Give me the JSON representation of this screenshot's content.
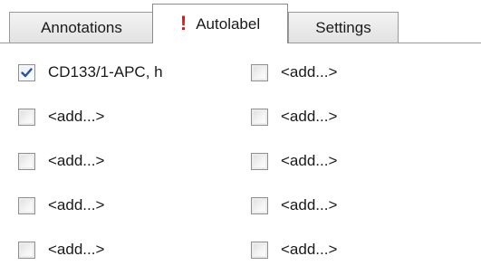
{
  "tabs": {
    "annotations": "Annotations",
    "autolabel": "Autolabel",
    "settings": "Settings",
    "active": "autolabel"
  },
  "icons": {
    "autolabel_tab_icon": "exclamation-alert-icon",
    "checkbox_checked_icon": "checkmark-icon"
  },
  "colors": {
    "alert": "#e51414",
    "checkmark": "#2a4f9c"
  },
  "labels": {
    "left": [
      {
        "text": "CD133/1-APC, h",
        "checked": true
      },
      {
        "text": "<add...>",
        "checked": false
      },
      {
        "text": "<add...>",
        "checked": false
      },
      {
        "text": "<add...>",
        "checked": false
      },
      {
        "text": "<add...>",
        "checked": false
      }
    ],
    "right": [
      {
        "text": "<add...>",
        "checked": false
      },
      {
        "text": "<add...>",
        "checked": false
      },
      {
        "text": "<add...>",
        "checked": false
      },
      {
        "text": "<add...>",
        "checked": false
      },
      {
        "text": "<add...>",
        "checked": false
      }
    ]
  }
}
